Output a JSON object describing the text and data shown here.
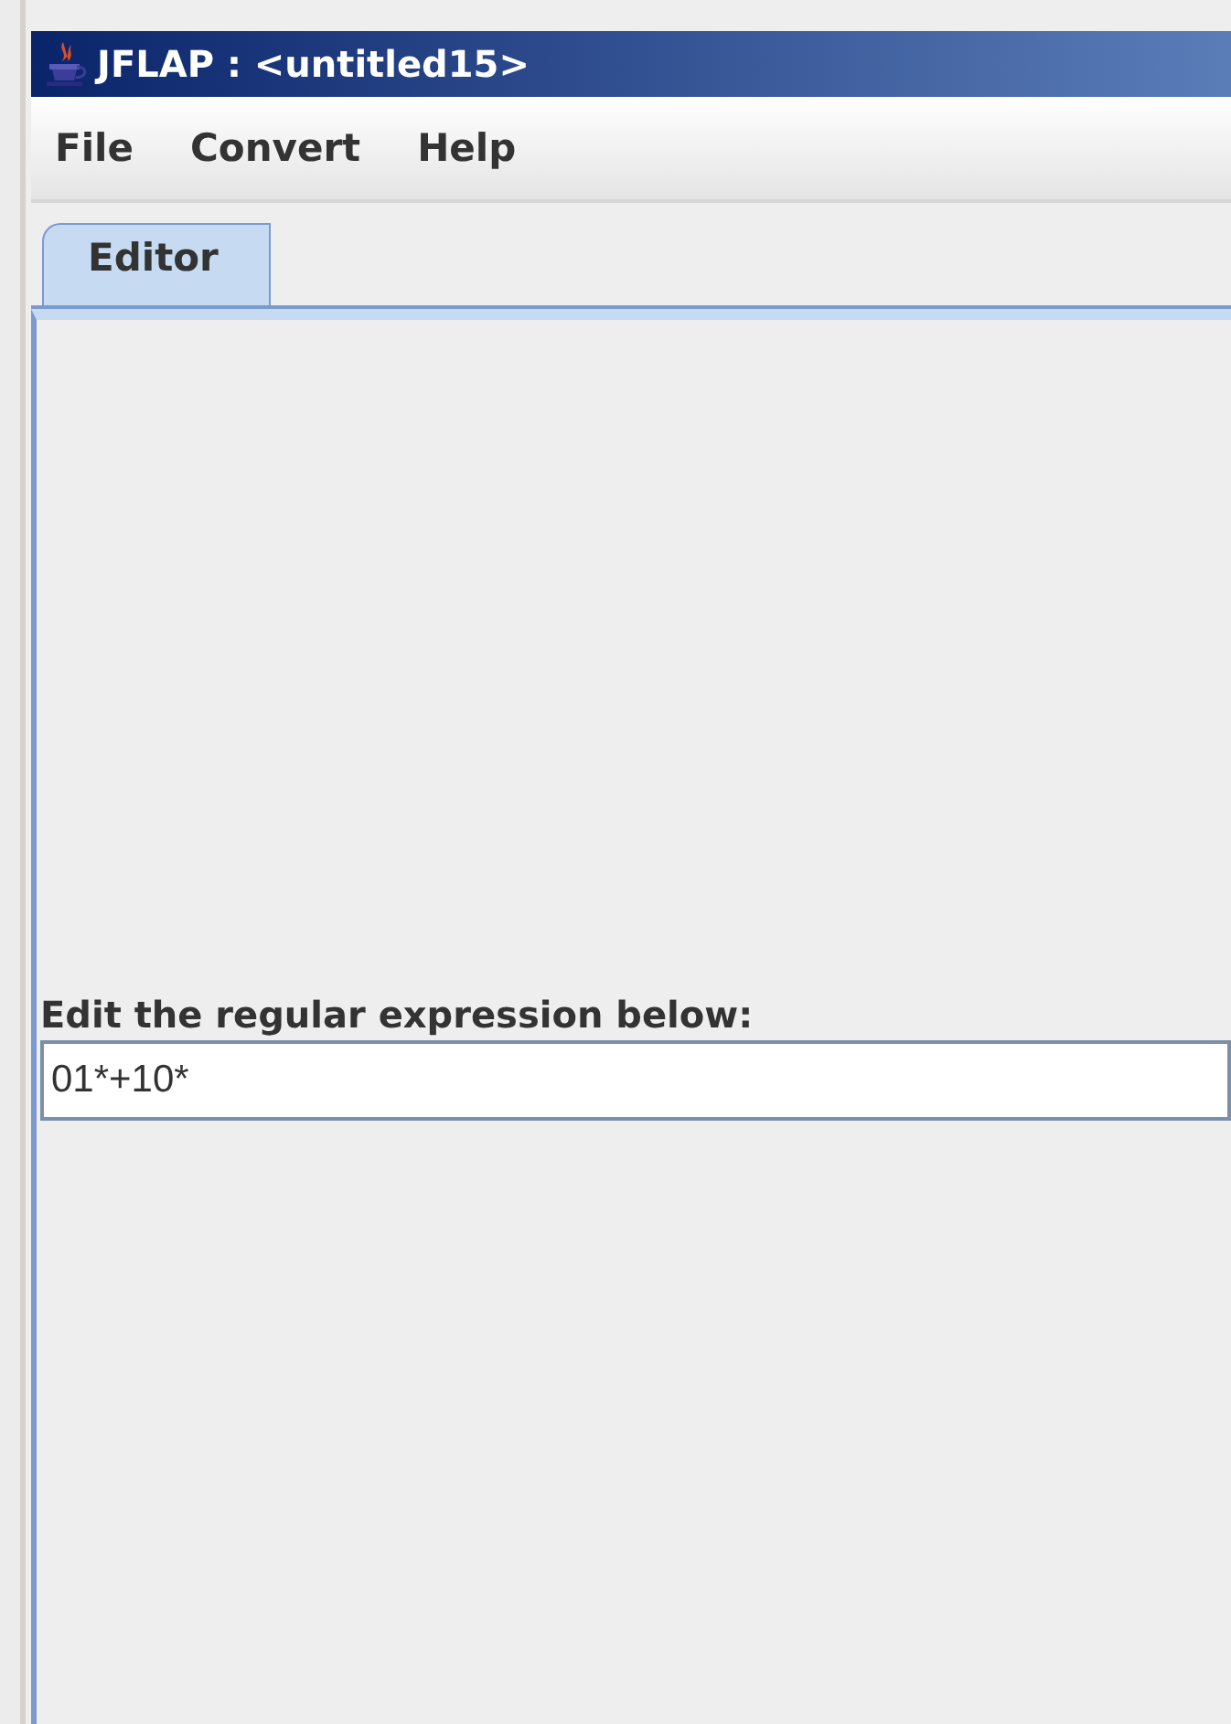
{
  "window": {
    "title": "JFLAP : <untitled15>"
  },
  "menu": [
    "File",
    "Convert",
    "Help"
  ],
  "tabs": [
    {
      "label": "Editor",
      "selected": true
    }
  ],
  "editor": {
    "label": "Edit the regular expression below:",
    "value": "01*+10*"
  }
}
